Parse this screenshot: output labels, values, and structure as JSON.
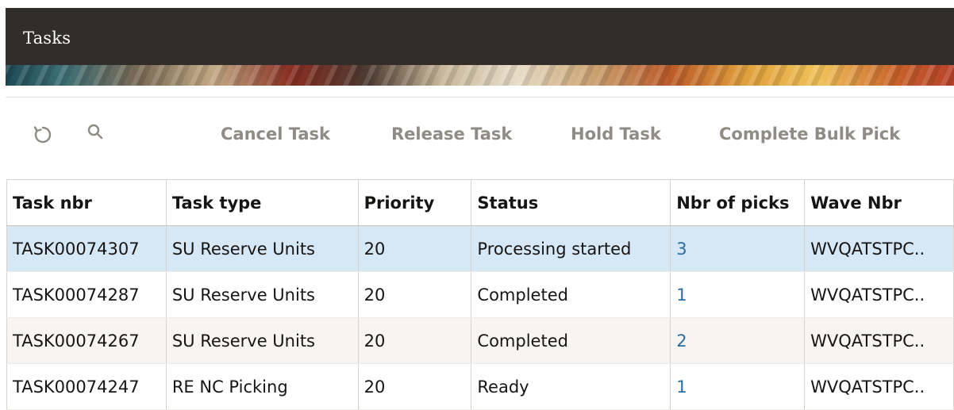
{
  "header": {
    "title": "Tasks"
  },
  "toolbar": {
    "refresh_icon": "refresh-icon",
    "search_icon": "search-icon",
    "buttons": [
      "Cancel Task",
      "Release Task",
      "Hold Task",
      "Complete Bulk Pick"
    ]
  },
  "table": {
    "columns": [
      "Task nbr",
      "Task type",
      "Priority",
      "Status",
      "Nbr of picks",
      "Wave Nbr"
    ],
    "rows": [
      [
        "TASK00074307",
        "SU Reserve Units",
        "20",
        "Processing started",
        "3",
        "WVQATSTPC.."
      ],
      [
        "TASK00074287",
        "SU Reserve Units",
        "20",
        "Completed",
        "1",
        "WVQATSTPC.."
      ],
      [
        "TASK00074267",
        "SU Reserve Units",
        "20",
        "Completed",
        "2",
        "WVQATSTPC.."
      ],
      [
        "TASK00074247",
        "RE NC Picking",
        "20",
        "Ready",
        "1",
        "WVQATSTPC.."
      ]
    ],
    "selected_row": 0
  },
  "colors": {
    "header_bg": "#312d2a",
    "selected_row_bg": "#d6e7f5",
    "alt_row_bg": "#f6f5f4",
    "link": "#2b6d9e",
    "toolbar_text": "#8f8b86"
  }
}
